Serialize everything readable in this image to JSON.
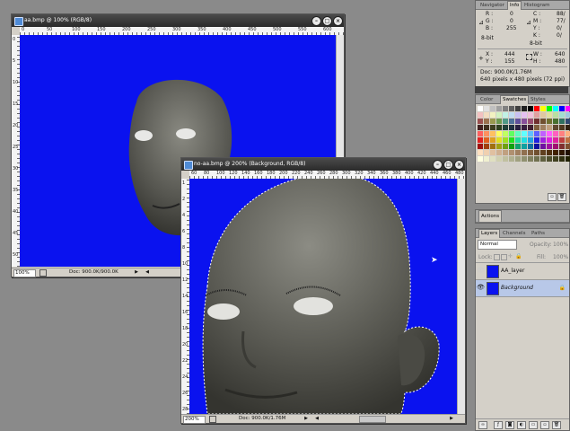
{
  "doc1": {
    "title": "aa.bmp @ 100% (RGB/8)",
    "ruler_h": [
      "0",
      "50",
      "100",
      "150",
      "200",
      "250",
      "300",
      "350",
      "400",
      "450",
      "500",
      "550",
      "600"
    ],
    "ruler_v": [
      "0",
      "5",
      "10",
      "15",
      "20",
      "25",
      "30",
      "35",
      "40",
      "45",
      "50"
    ],
    "zoom": "100%",
    "doc": "Doc: 900.0K/900.0K",
    "icons": {
      "app": "document-icon",
      "minimize": "minimize-icon",
      "maximize": "maximize-icon",
      "close": "close-icon"
    }
  },
  "doc2": {
    "title": "no-aa.bmp @ 200% (Background, RGB/8)",
    "ruler_h": [
      "60",
      "80",
      "100",
      "120",
      "140",
      "160",
      "180",
      "200",
      "220",
      "240",
      "260",
      "280",
      "300",
      "320",
      "340",
      "360",
      "380",
      "400",
      "420",
      "440",
      "460",
      "480"
    ],
    "ruler_v": [
      "1",
      "2",
      "4",
      "6",
      "8",
      "10",
      "12",
      "14",
      "16",
      "18",
      "20",
      "22",
      "24",
      "26",
      "28"
    ],
    "zoom": "200%",
    "doc": "Doc: 900.0K/1.76M",
    "icons": {
      "app": "document-icon",
      "minimize": "minimize-icon",
      "maximize": "maximize-icon",
      "close": "close-icon"
    }
  },
  "info_panel": {
    "tabs": [
      "Navigator",
      "Info",
      "Histogram"
    ],
    "active_tab": "Info",
    "r": "R :",
    "r_val": "0",
    "g": "G :",
    "g_val": "0",
    "b": "B :",
    "b_val": "255",
    "bit1": "8-bit",
    "c": "C :",
    "c_val": "88/",
    "m": "M :",
    "m_val": "77/",
    "y": "Y :",
    "y_val": "0/",
    "k": "K :",
    "k_val": "0/",
    "bit2": "8-bit",
    "x": "X :",
    "x_val": "444",
    "yy": "Y :",
    "yy_val": "155",
    "w": "W :",
    "w_val": "640",
    "h": "H :",
    "h_val": "480",
    "doc": "Doc: 900.0K/1.76M",
    "pixels": "640 pixels x 480 pixels (72 ppi)"
  },
  "swatches_panel": {
    "tabs": [
      "Color",
      "Swatches",
      "Styles"
    ],
    "active_tab": "Swatches",
    "colors": [
      "#ffffff",
      "#e0e0e0",
      "#c0c0c0",
      "#a0a0a0",
      "#808080",
      "#606060",
      "#404040",
      "#202020",
      "#000000",
      "#ff0000",
      "#ffff00",
      "#00ff00",
      "#00ffff",
      "#0000ff",
      "#ff00ff",
      "#ffffff",
      "#f2c0c0",
      "#f2dcc0",
      "#f2f2c0",
      "#d0f2c0",
      "#c0f2e6",
      "#c0dcf2",
      "#c8c0f2",
      "#e6c0f2",
      "#f2c0dc",
      "#e0a0a0",
      "#e0c8a0",
      "#e0e0a0",
      "#b8e0a0",
      "#a0e0d0",
      "#a0c8e0",
      "#b8a0e0",
      "#9a5050",
      "#9a7250",
      "#9a9a50",
      "#6e9a50",
      "#509a88",
      "#50729a",
      "#60509a",
      "#88509a",
      "#9a5072",
      "#703030",
      "#705030",
      "#707030",
      "#487030",
      "#307060",
      "#304870",
      "#403070",
      "#402020",
      "#403020",
      "#404020",
      "#304020",
      "#204038",
      "#203040",
      "#282040",
      "#382040",
      "#402030",
      "#806040",
      "#a08060",
      "#c0a080",
      "#604830",
      "#503820",
      "#302010",
      "#201008",
      "#ff6060",
      "#ff9060",
      "#ffc060",
      "#ffff60",
      "#c0ff60",
      "#60ff60",
      "#60ffc0",
      "#60ffff",
      "#60c0ff",
      "#6060ff",
      "#c060ff",
      "#ff60ff",
      "#ff60c0",
      "#ff8080",
      "#ffb080",
      "#ffd080",
      "#e02020",
      "#e06020",
      "#e0a020",
      "#e0e020",
      "#a0e020",
      "#20e020",
      "#20e0a0",
      "#20e0e0",
      "#20a0e0",
      "#2020e0",
      "#a020e0",
      "#e020e0",
      "#e020a0",
      "#c04040",
      "#c07040",
      "#c0a040",
      "#a01010",
      "#a04010",
      "#a07010",
      "#a0a010",
      "#70a010",
      "#10a010",
      "#10a070",
      "#10a0a0",
      "#1070a0",
      "#1010a0",
      "#7010a0",
      "#a010a0",
      "#a01070",
      "#803030",
      "#805030",
      "#807030",
      "#ffe0c0",
      "#f0d0b0",
      "#e0c0a0",
      "#d0b090",
      "#c0a080",
      "#b09070",
      "#a08060",
      "#907050",
      "#806040",
      "#705030",
      "#604020",
      "#503010",
      "#402000",
      "#301800",
      "#201000",
      "#100800",
      "#ffffe0",
      "#f0f0d0",
      "#e0e0c0",
      "#d0d0b0",
      "#c0c0a0",
      "#b0b090",
      "#a0a080",
      "#909070",
      "#808060",
      "#707050",
      "#606040",
      "#505030",
      "#404020",
      "#303010",
      "#202000",
      "#101000"
    ]
  },
  "actions_panel": {
    "tab": "Actions"
  },
  "layers_panel": {
    "tabs": [
      "Layers",
      "Channels",
      "Paths"
    ],
    "active_tab": "Layers",
    "blend_mode": "Normal",
    "opacity_label": "Opacity:",
    "opacity_value": "100%",
    "lock_label": "Lock:",
    "fill_label": "Fill:",
    "fill_value": "100%",
    "layers": [
      {
        "name": "AA_layer",
        "visible": true,
        "selected": false
      },
      {
        "name": "Background",
        "visible": true,
        "selected": true
      }
    ]
  }
}
